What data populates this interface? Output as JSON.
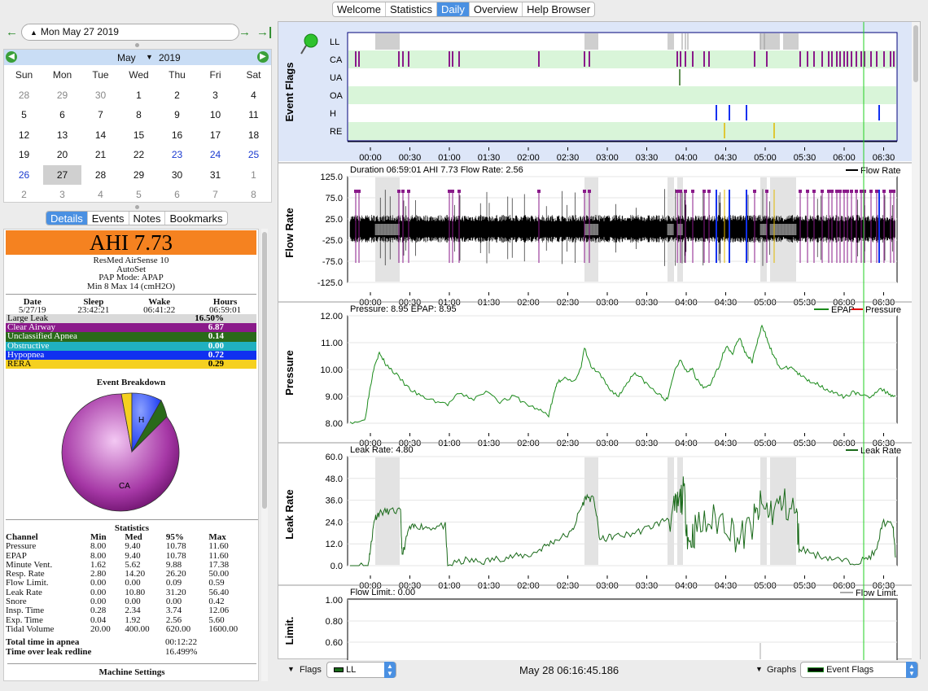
{
  "tabs": [
    "Welcome",
    "Statistics",
    "Daily",
    "Overview",
    "Help Browser"
  ],
  "nav": {
    "date": "Mon May 27 2019"
  },
  "calendar": {
    "month": "May",
    "year": "2019",
    "dow": [
      "Sun",
      "Mon",
      "Tue",
      "Wed",
      "Thu",
      "Fri",
      "Sat"
    ],
    "days": [
      "28",
      "29",
      "30",
      "1",
      "2",
      "3",
      "4",
      "5",
      "6",
      "7",
      "8",
      "9",
      "10",
      "11",
      "12",
      "13",
      "14",
      "15",
      "16",
      "17",
      "18",
      "19",
      "20",
      "21",
      "22",
      "23",
      "24",
      "25",
      "26",
      "27",
      "28",
      "29",
      "30",
      "31",
      "1",
      "2",
      "3",
      "4",
      "5",
      "6",
      "7",
      "8"
    ]
  },
  "detail_tabs": [
    "Details",
    "Events",
    "Notes",
    "Bookmarks"
  ],
  "summary": {
    "ahi": "AHI 7.73",
    "machine": [
      "ResMed AirSense 10",
      "AutoSet",
      "PAP Mode: APAP",
      "Min 8 Max 14 (cmH2O)"
    ],
    "headers": [
      "Date",
      "Sleep",
      "Wake",
      "Hours"
    ],
    "values": [
      "5/27/19",
      "23:42:21",
      "06:41:22",
      "06:59:01"
    ]
  },
  "events": [
    {
      "label": "Large Leak",
      "value": "16.50%",
      "color": "#d9d9d9",
      "text": "#000"
    },
    {
      "label": "Clear Airway",
      "value": "6.87",
      "color": "#8a1a8a",
      "text": "#fff"
    },
    {
      "label": "Unclassified Apnea",
      "value": "0.14",
      "color": "#2a6a1a",
      "text": "#fff"
    },
    {
      "label": "Obstructive",
      "value": "0.00",
      "color": "#20b0c0",
      "text": "#fff"
    },
    {
      "label": "Hypopnea",
      "value": "0.72",
      "color": "#1030f0",
      "text": "#fff"
    },
    {
      "label": "RERA",
      "value": "0.29",
      "color": "#f5d020",
      "text": "#000"
    }
  ],
  "pie": {
    "title": "Event Breakdown",
    "labels": [
      "H",
      "CA"
    ]
  },
  "statistics": {
    "title": "Statistics",
    "headers": [
      "Channel",
      "Min",
      "Med",
      "95%",
      "Max"
    ],
    "rows": [
      [
        "Pressure",
        "8.00",
        "9.40",
        "10.78",
        "11.60"
      ],
      [
        "EPAP",
        "8.00",
        "9.40",
        "10.78",
        "11.60"
      ],
      [
        "Minute Vent.",
        "1.62",
        "5.62",
        "9.88",
        "17.38"
      ],
      [
        "Resp. Rate",
        "2.80",
        "14.20",
        "26.20",
        "50.00"
      ],
      [
        "Flow Limit.",
        "0.00",
        "0.00",
        "0.09",
        "0.59"
      ],
      [
        "Leak Rate",
        "0.00",
        "10.80",
        "31.20",
        "56.40"
      ],
      [
        "Snore",
        "0.00",
        "0.00",
        "0.00",
        "0.42"
      ],
      [
        "Insp. Time",
        "0.28",
        "2.34",
        "3.74",
        "12.06"
      ],
      [
        "Exp. Time",
        "0.04",
        "1.92",
        "2.56",
        "5.60"
      ],
      [
        "Tidal Volume",
        "20.00",
        "400.00",
        "620.00",
        "1600.00"
      ]
    ],
    "apnea_label": "Total time in apnea",
    "apnea_value": "00:12:22",
    "leak_label": "Time over leak redline",
    "leak_value": "16.499%",
    "machine_settings": "Machine Settings"
  },
  "graphs": {
    "time_ticks": [
      "00:00",
      "00:30",
      "01:00",
      "01:30",
      "02:00",
      "02:30",
      "03:00",
      "03:30",
      "04:00",
      "04:30",
      "05:00",
      "05:30",
      "06:00",
      "06:30"
    ],
    "event_flags": {
      "title": "Event Flags",
      "rows": [
        "LL",
        "CA",
        "UA",
        "OA",
        "H",
        "RE"
      ]
    },
    "flow": {
      "title": "Flow Rate",
      "header": "Duration 06:59:01 AHI 7.73 Flow Rate: 2.56",
      "legend": "Flow Rate",
      "ticks": [
        "125.0",
        "75.0",
        "25.0",
        "-25.0",
        "-75.0",
        "-125.0"
      ]
    },
    "pressure": {
      "title": "Pressure",
      "header": "Pressure: 8.95 EPAP: 8.95",
      "legend": [
        "EPAP",
        "Pressure"
      ],
      "ticks": [
        "12.00",
        "11.00",
        "10.00",
        "9.00",
        "8.00"
      ]
    },
    "leak": {
      "title": "Leak Rate",
      "header": "Leak Rate: 4.80",
      "legend": "Leak Rate",
      "ticks": [
        "60.0",
        "48.0",
        "36.0",
        "24.0",
        "12.0",
        "0.0"
      ]
    },
    "flowlimit": {
      "title": "Limit.",
      "header": "Flow Limit.: 0.00",
      "legend": "Flow Limit.",
      "ticks": [
        "1.00",
        "0.80",
        "0.60"
      ]
    }
  },
  "bottom": {
    "flags_label": "Flags",
    "flags_value": "LL",
    "timestamp": "May 28 06:16:45.186",
    "graphs_label": "Graphs",
    "graphs_value": "Event Flags"
  },
  "colors": {
    "ca": "#8a1a8a",
    "h": "#1030f0",
    "re": "#f5d020",
    "ua": "#2a6a1a",
    "green": "#1a8a1a"
  }
}
